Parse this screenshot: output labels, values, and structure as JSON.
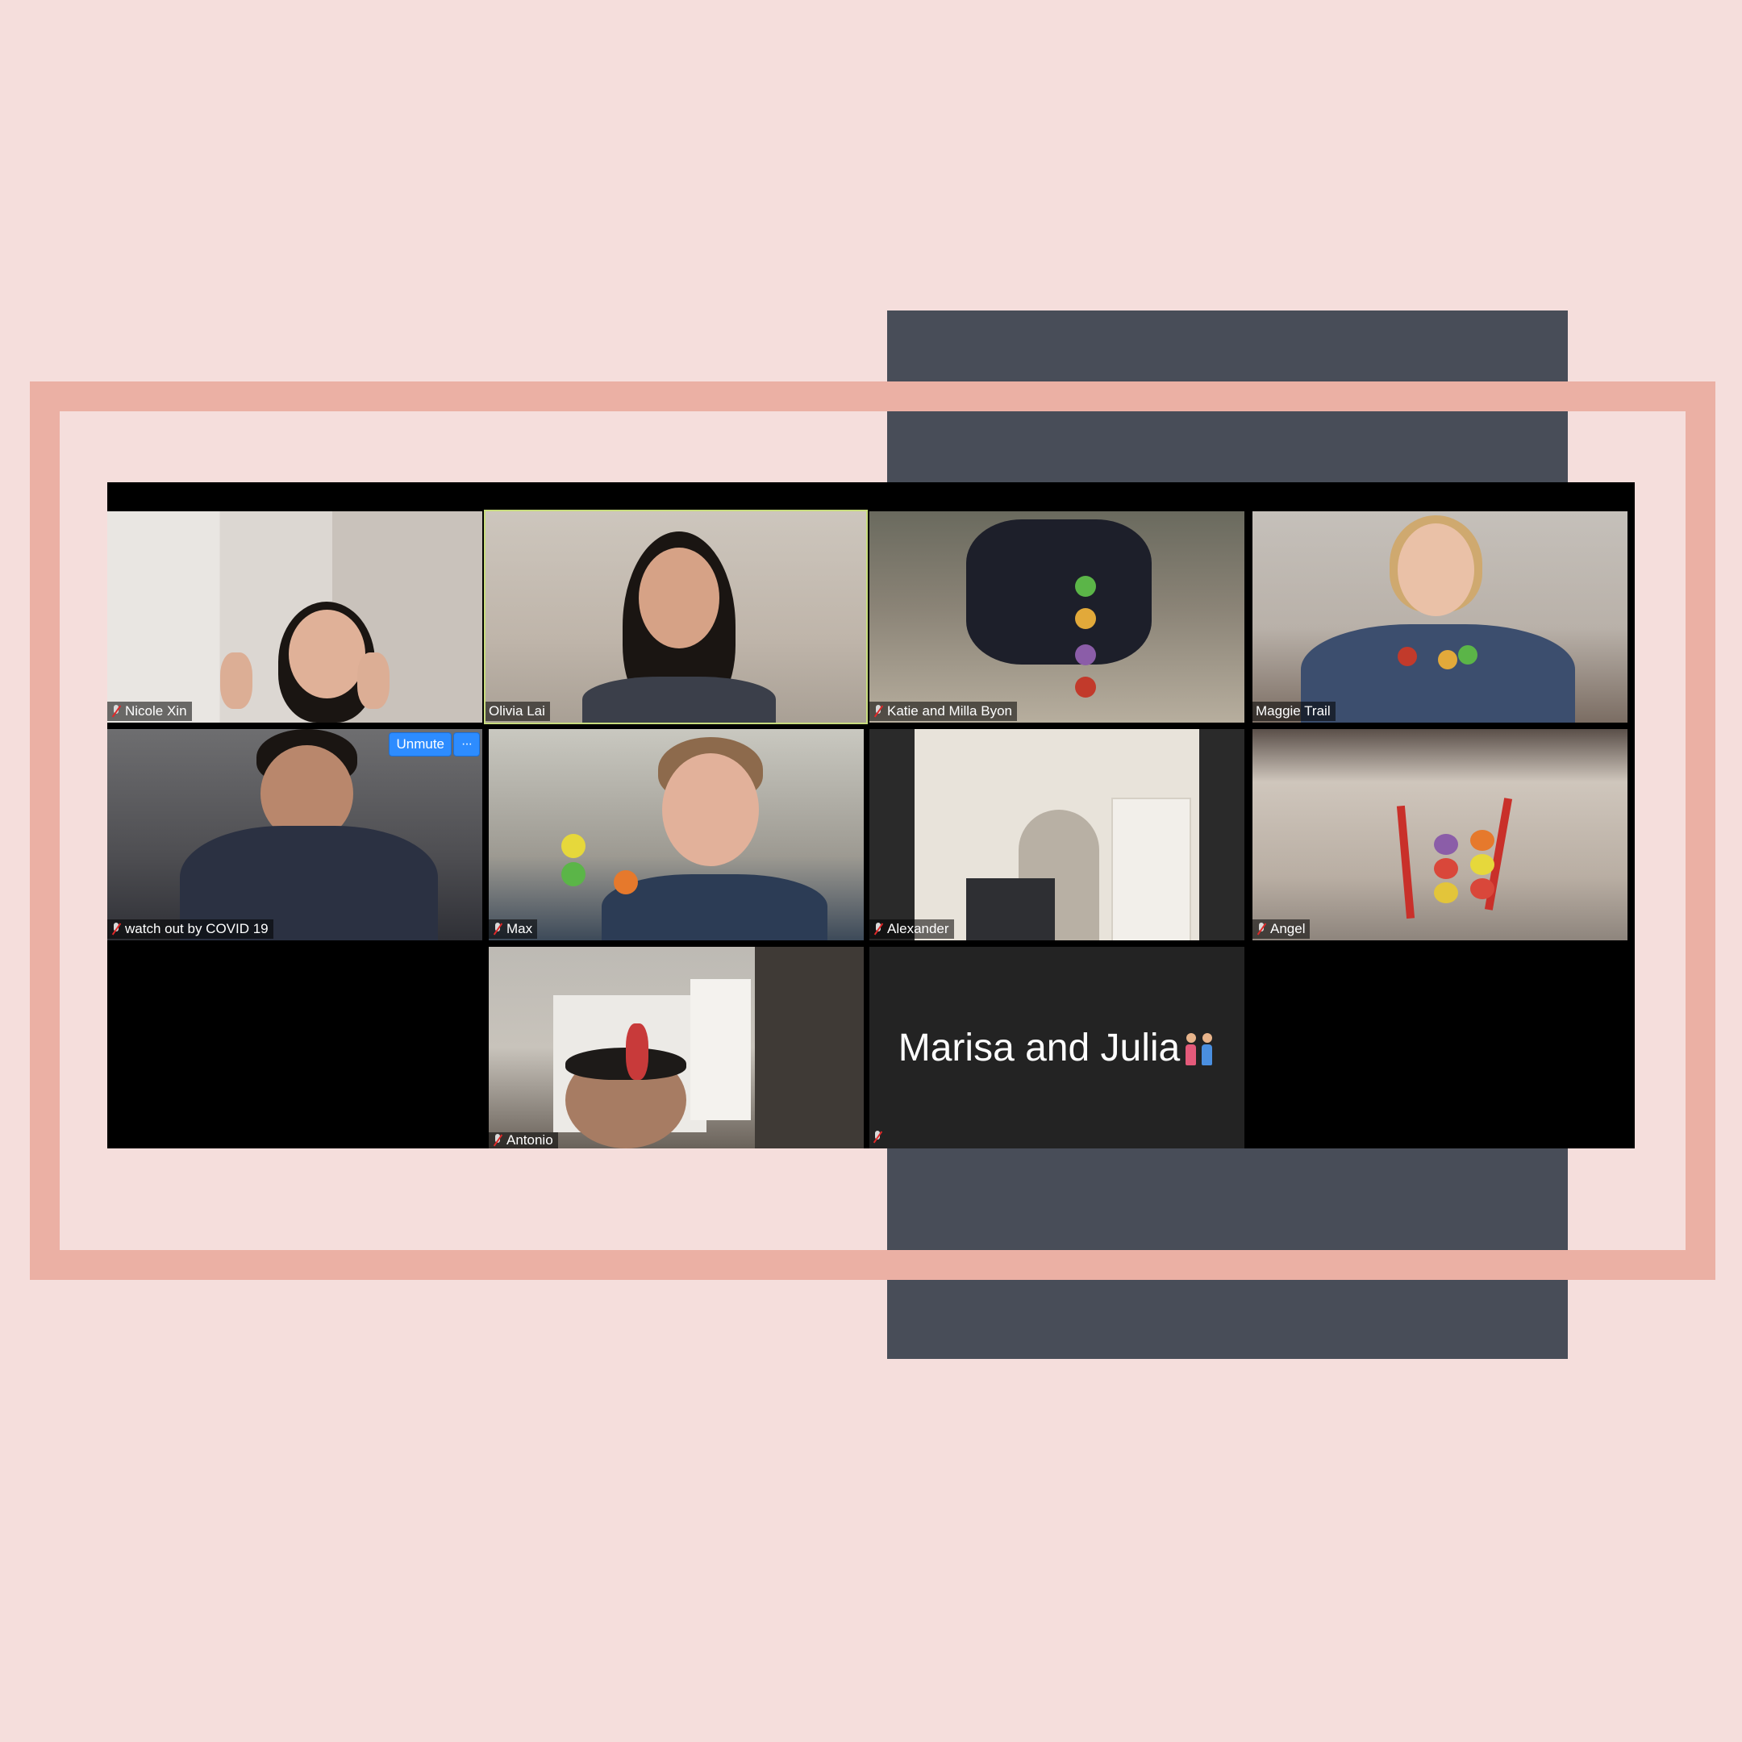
{
  "meeting": {
    "participants": [
      {
        "name": "Nicole Xin",
        "muted": true
      },
      {
        "name": "Olivia Lai",
        "muted": false,
        "active_speaker": true
      },
      {
        "name": "Katie and Milla Byon",
        "muted": true
      },
      {
        "name": "Maggie Trail",
        "muted": false
      },
      {
        "name": "watch out by COVID 19",
        "muted": true
      },
      {
        "name": "Max",
        "muted": true
      },
      {
        "name": "Alexander",
        "muted": true
      },
      {
        "name": "Angel",
        "muted": true
      },
      {
        "name": "Antonio",
        "muted": true
      },
      {
        "name": "Marisa and Julia",
        "muted": true,
        "video_off": true
      }
    ],
    "hover_controls": {
      "unmute_label": "Unmute",
      "more_label": "···"
    }
  },
  "colors": {
    "background": "#f5dedc",
    "frame": "#ebb0a4",
    "dark_block": "#484d58",
    "active_speaker_border": "#c8dc7d",
    "button_blue": "#2d8cff"
  }
}
